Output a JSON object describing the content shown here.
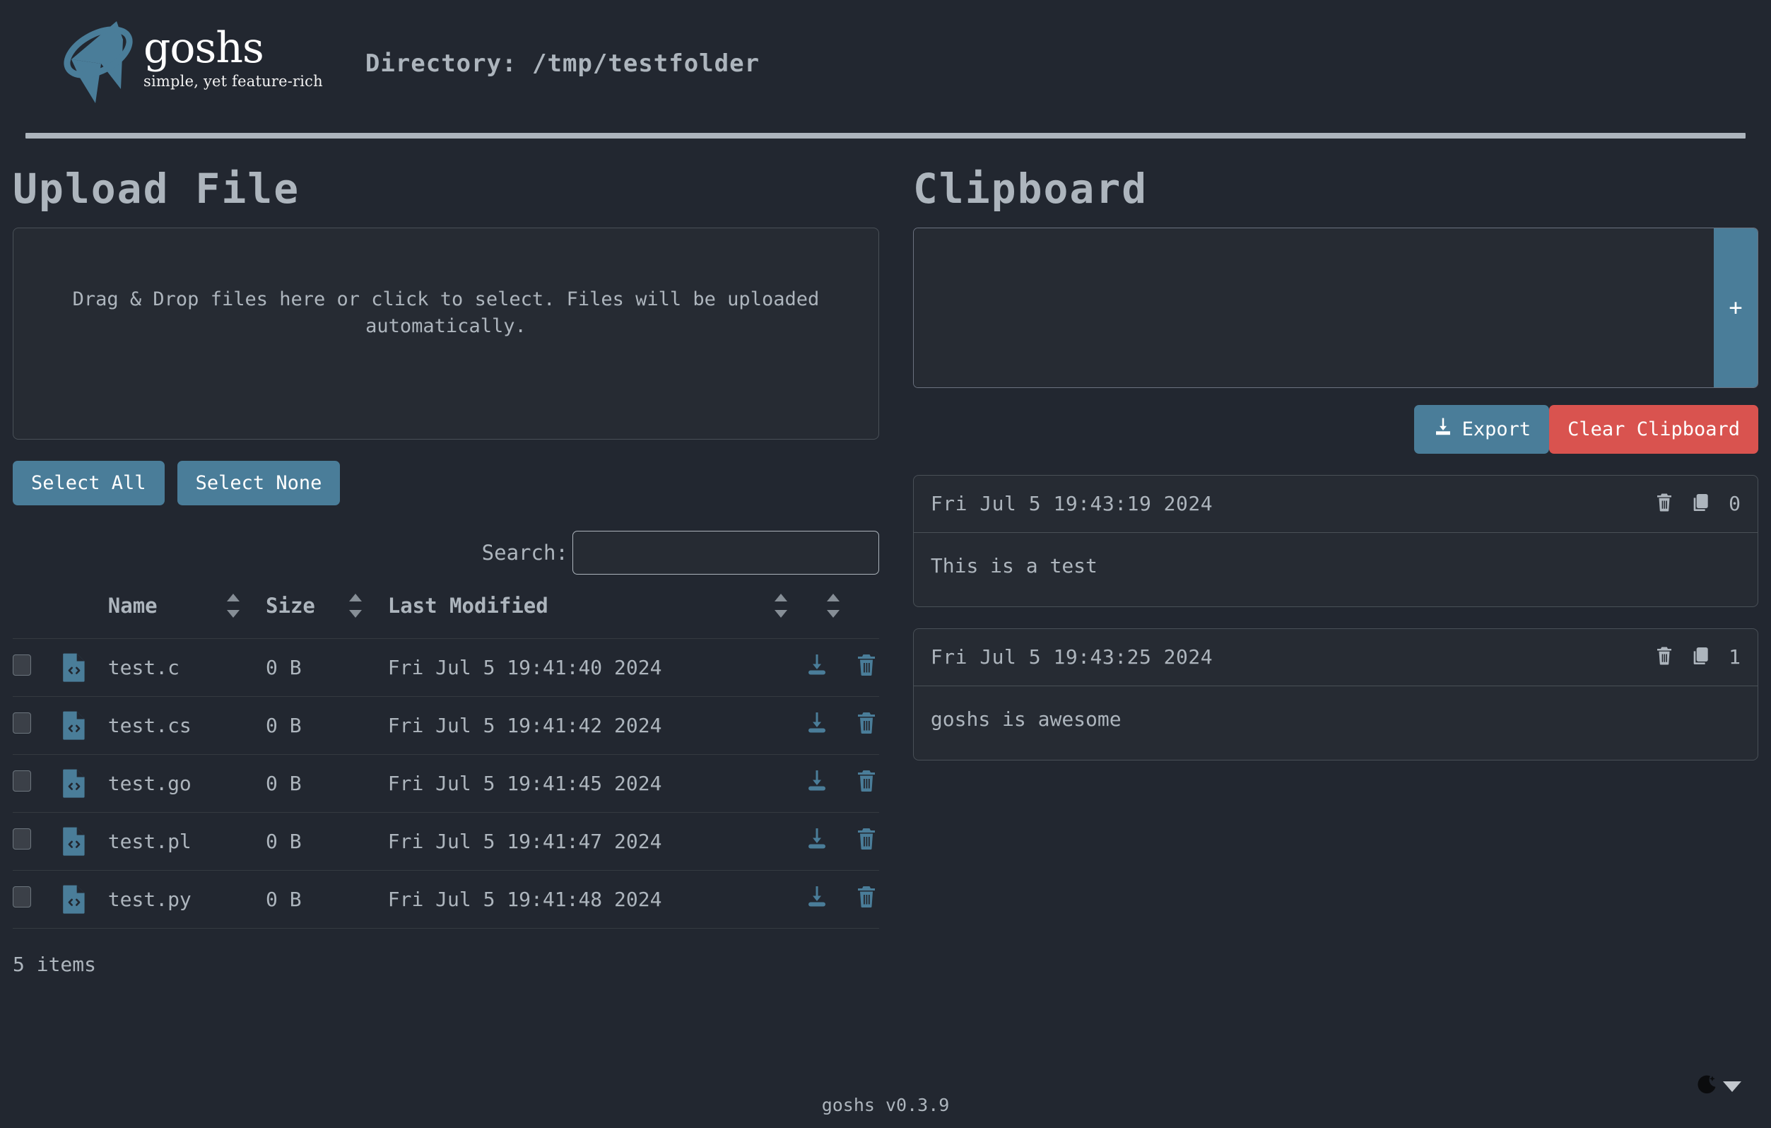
{
  "brand": {
    "name": "goshs",
    "tagline": "simple, yet feature-rich",
    "logo_icon": "goshs-planet-logo"
  },
  "header": {
    "directory_title": "Directory: /tmp/testfolder"
  },
  "upload": {
    "section_title": "Upload File",
    "dropzone_text": "Drag & Drop files here or click to select. Files will be uploaded automatically.",
    "select_all_label": "Select All",
    "select_none_label": "Select None"
  },
  "search": {
    "label": "Search:",
    "value": "",
    "placeholder": ""
  },
  "table": {
    "columns": [
      "Name",
      "Size",
      "Last Modified"
    ],
    "rows": [
      {
        "name": "test.c",
        "size": "0 B",
        "modified": "Fri Jul 5 19:41:40 2024",
        "icon": "code-file-icon",
        "checked": false
      },
      {
        "name": "test.cs",
        "size": "0 B",
        "modified": "Fri Jul 5 19:41:42 2024",
        "icon": "code-file-icon",
        "checked": false
      },
      {
        "name": "test.go",
        "size": "0 B",
        "modified": "Fri Jul 5 19:41:45 2024",
        "icon": "code-file-icon",
        "checked": false
      },
      {
        "name": "test.pl",
        "size": "0 B",
        "modified": "Fri Jul 5 19:41:47 2024",
        "icon": "code-file-icon",
        "checked": false
      },
      {
        "name": "test.py",
        "size": "0 B",
        "modified": "Fri Jul 5 19:41:48 2024",
        "icon": "code-file-icon",
        "checked": false
      }
    ],
    "items_count": "5 items"
  },
  "clipboard": {
    "section_title": "Clipboard",
    "input_value": "",
    "input_placeholder": "",
    "add_label": "+",
    "export_label": "Export",
    "clear_label": "Clear Clipboard",
    "entries": [
      {
        "time": "Fri Jul 5 19:43:19 2024",
        "id": "0",
        "content": "This is a test"
      },
      {
        "time": "Fri Jul 5 19:43:25 2024",
        "id": "1",
        "content": "goshs is awesome"
      }
    ]
  },
  "footer": {
    "version": "goshs v0.3.9",
    "theme_icon": "moon-icon"
  },
  "colors": {
    "background": "#222730",
    "accent_blue": "#4a7d99",
    "danger_red": "#d9534f",
    "text_muted": "#adb5bd",
    "rule": "#adb5bd"
  }
}
